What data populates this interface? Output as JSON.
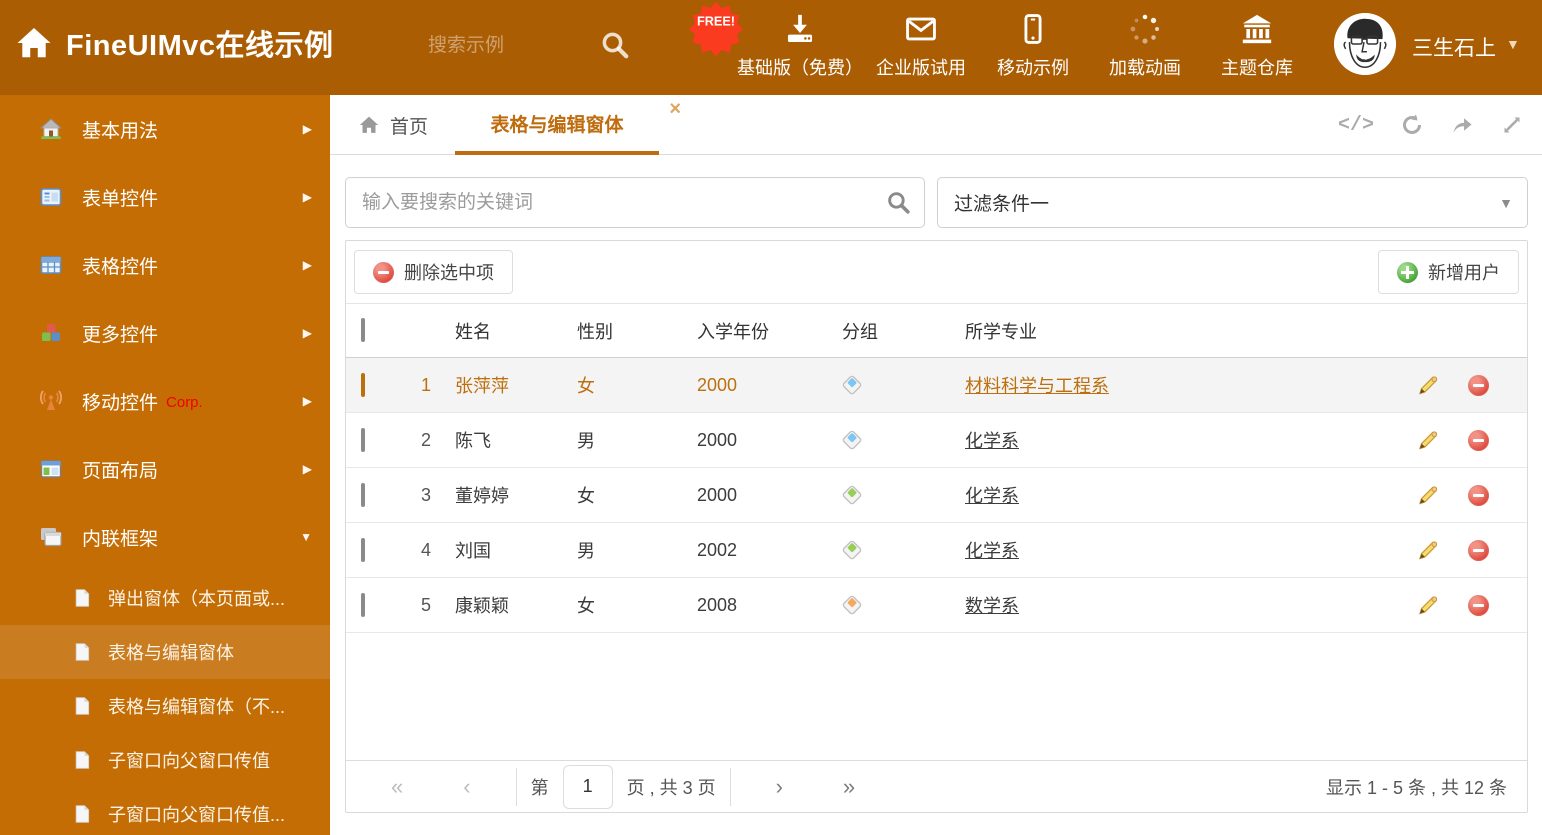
{
  "icons": {
    "chevron_right": "▶",
    "chevron_down": "▼",
    "caret_down": "▼",
    "close": "×",
    "code": "</>",
    "first": "«",
    "prev": "‹",
    "next": "›",
    "last": "»"
  },
  "colors": {
    "header_bg": "#AB5D04",
    "sidebar_bg": "#C46D05",
    "sidebar_active_bg": "#CA7C20",
    "accent_orange": "#BE6C0E",
    "free_badge_red": "#FA3B1F",
    "delete_red": "#DD4538",
    "add_green": "#46A335",
    "tag_blue": "#7CC5F5",
    "tag_green": "#97CE59",
    "tag_orange": "#F5A95F",
    "selected_row_bg": "#F4F4F4"
  },
  "header": {
    "title": "FineUIMvc在线示例",
    "search_placeholder": "搜索示例",
    "free_badge": "FREE!",
    "nav": [
      {
        "label": "基础版（免费）"
      },
      {
        "label": "企业版试用"
      },
      {
        "label": "移动示例"
      },
      {
        "label": "加载动画"
      },
      {
        "label": "主题仓库"
      }
    ],
    "user_name": "三生石上"
  },
  "sidebar": {
    "items": [
      {
        "label": "基本用法"
      },
      {
        "label": "表单控件"
      },
      {
        "label": "表格控件"
      },
      {
        "label": "更多控件"
      },
      {
        "label": "移动控件",
        "badge": "Corp."
      },
      {
        "label": "页面布局"
      },
      {
        "label": "内联框架"
      }
    ],
    "subitems": [
      {
        "label": "弹出窗体（本页面或..."
      },
      {
        "label": "表格与编辑窗体"
      },
      {
        "label": "表格与编辑窗体（不..."
      },
      {
        "label": "子窗口向父窗口传值"
      },
      {
        "label": "子窗口向父窗口传值..."
      }
    ]
  },
  "tabs": {
    "home_label": "首页",
    "active_label": "表格与编辑窗体"
  },
  "filters": {
    "search_placeholder": "输入要搜索的关键词",
    "filter_value": "过滤条件一"
  },
  "toolbar": {
    "delete_label": "删除选中项",
    "add_label": "新增用户"
  },
  "table": {
    "columns": {
      "name": "姓名",
      "gender": "性别",
      "year": "入学年份",
      "group": "分组",
      "major": "所学专业"
    },
    "rows": [
      {
        "num": "1",
        "name": "张萍萍",
        "gender": "女",
        "year": "2000",
        "tag": "blue",
        "major": "材料科学与工程系"
      },
      {
        "num": "2",
        "name": "陈飞",
        "gender": "男",
        "year": "2000",
        "tag": "blue",
        "major": "化学系"
      },
      {
        "num": "3",
        "name": "董婷婷",
        "gender": "女",
        "year": "2000",
        "tag": "green",
        "major": "化学系"
      },
      {
        "num": "4",
        "name": "刘国",
        "gender": "男",
        "year": "2002",
        "tag": "green",
        "major": "化学系"
      },
      {
        "num": "5",
        "name": "康颖颖",
        "gender": "女",
        "year": "2008",
        "tag": "orange",
        "major": "数学系"
      }
    ]
  },
  "pagination": {
    "page_prefix": "第",
    "page_value": "1",
    "page_suffix": "页 , 共 3 页",
    "summary": "显示 1 - 5 条 , 共 12 条"
  }
}
